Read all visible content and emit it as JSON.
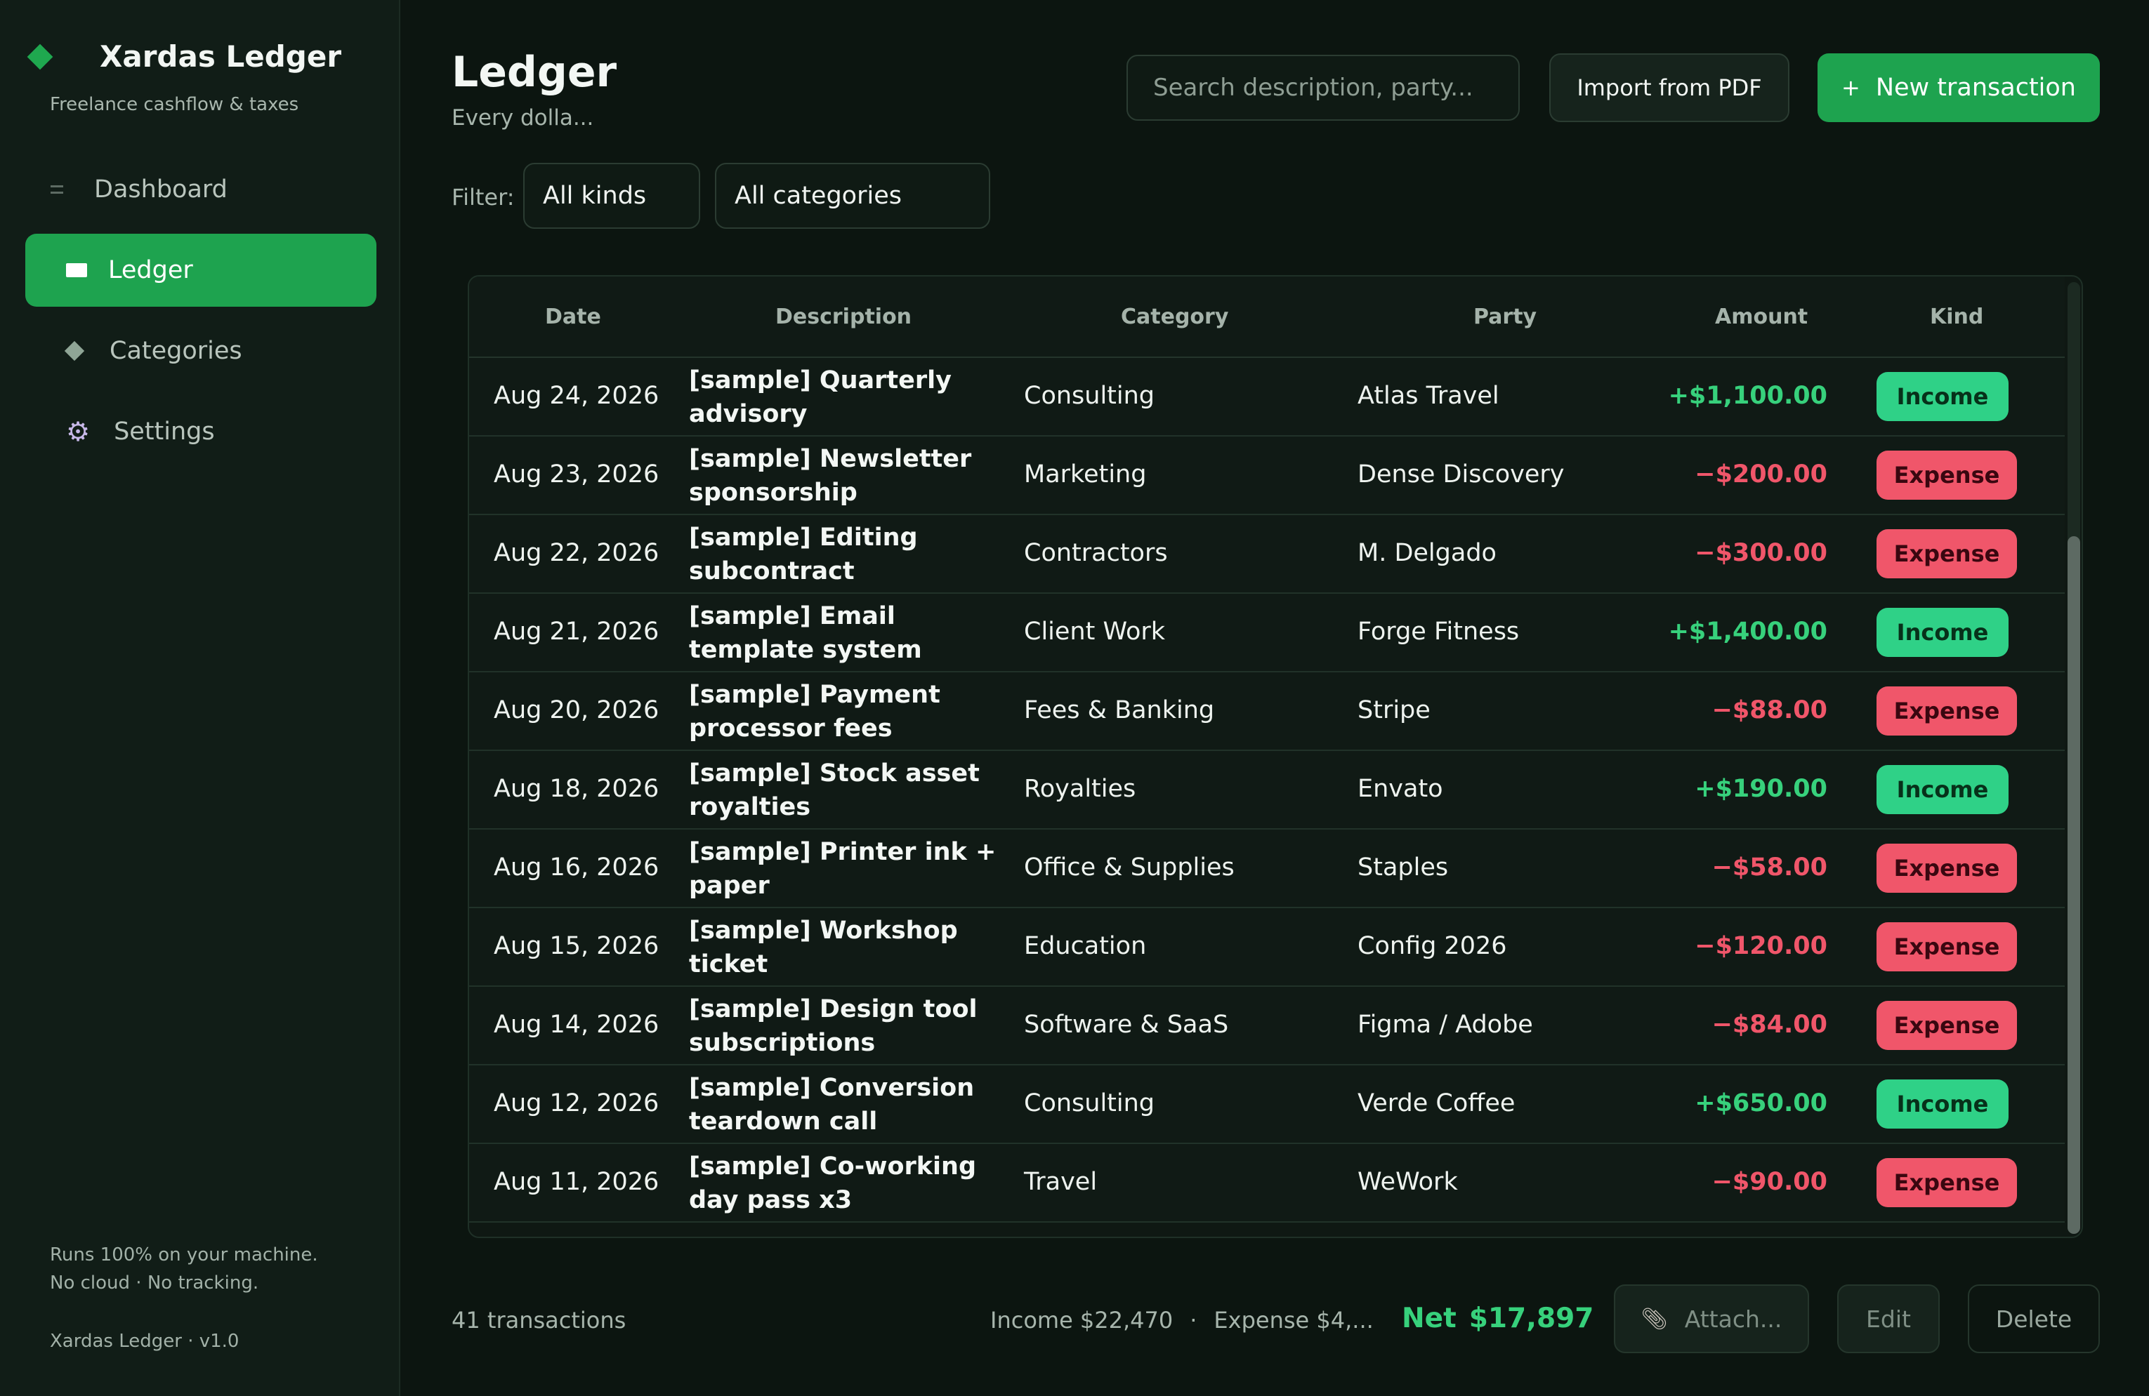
{
  "app": {
    "name": "Xardas Ledger",
    "tagline": "Freelance cashflow & taxes",
    "footer_line1": "Runs 100% on your machine.",
    "footer_line2": "No cloud · No tracking.",
    "version": "Xardas Ledger · v1.0",
    "accent_color": "#1ea34f"
  },
  "nav": {
    "items": [
      {
        "label": "Dashboard",
        "icon": "dashboard-icon",
        "active": false
      },
      {
        "label": "Ledger",
        "icon": "ledger-icon",
        "active": true
      },
      {
        "label": "Categories",
        "icon": "diamond-icon",
        "active": false
      },
      {
        "label": "Settings",
        "icon": "gear-icon",
        "active": false
      }
    ]
  },
  "header": {
    "title": "Ledger",
    "subtitle": "Every dolla...",
    "search_placeholder": "Search description, party...",
    "import_label": "Import from PDF",
    "new_label": "New transaction",
    "new_icon": "+"
  },
  "filters": {
    "label": "Filter:",
    "kind": "All kinds",
    "category": "All categories"
  },
  "table": {
    "headers": {
      "date": "Date",
      "description": "Description",
      "category": "Category",
      "party": "Party",
      "amount": "Amount",
      "kind": "Kind"
    },
    "rows": [
      {
        "date": "Aug 24, 2026",
        "description": "[sample] Quarterly advisory",
        "category": "Consulting",
        "party": "Atlas Travel",
        "amount": "+$1,100.00",
        "kind": "Income"
      },
      {
        "date": "Aug 23, 2026",
        "description": "[sample] Newsletter sponsorship",
        "category": "Marketing",
        "party": "Dense Discovery",
        "amount": "−$200.00",
        "kind": "Expense"
      },
      {
        "date": "Aug 22, 2026",
        "description": "[sample] Editing subcontract",
        "category": "Contractors",
        "party": "M. Delgado",
        "amount": "−$300.00",
        "kind": "Expense"
      },
      {
        "date": "Aug 21, 2026",
        "description": "[sample] Email template system",
        "category": "Client Work",
        "party": "Forge Fitness",
        "amount": "+$1,400.00",
        "kind": "Income"
      },
      {
        "date": "Aug 20, 2026",
        "description": "[sample] Payment processor fees",
        "category": "Fees & Banking",
        "party": "Stripe",
        "amount": "−$88.00",
        "kind": "Expense"
      },
      {
        "date": "Aug 18, 2026",
        "description": "[sample] Stock asset royalties",
        "category": "Royalties",
        "party": "Envato",
        "amount": "+$190.00",
        "kind": "Income"
      },
      {
        "date": "Aug 16, 2026",
        "description": "[sample] Printer ink + paper",
        "category": "Office & Supplies",
        "party": "Staples",
        "amount": "−$58.00",
        "kind": "Expense"
      },
      {
        "date": "Aug 15, 2026",
        "description": "[sample] Workshop ticket",
        "category": "Education",
        "party": "Config 2026",
        "amount": "−$120.00",
        "kind": "Expense"
      },
      {
        "date": "Aug 14, 2026",
        "description": "[sample] Design tool subscriptions",
        "category": "Software & SaaS",
        "party": "Figma / Adobe",
        "amount": "−$84.00",
        "kind": "Expense"
      },
      {
        "date": "Aug 12, 2026",
        "description": "[sample] Conversion teardown call",
        "category": "Consulting",
        "party": "Verde Coffee",
        "amount": "+$650.00",
        "kind": "Income"
      },
      {
        "date": "Aug 11, 2026",
        "description": "[sample] Co-working day pass x3",
        "category": "Travel",
        "party": "WeWork",
        "amount": "−$90.00",
        "kind": "Expense"
      }
    ]
  },
  "footer": {
    "count": "41 transactions",
    "income": "Income $22,470",
    "separator": "·",
    "expense": "Expense $4,...",
    "net_label": "Net",
    "net_value": "$17,897",
    "attach_label": "Attach...",
    "attach_icon": "paperclip-icon",
    "edit_label": "Edit",
    "delete_label": "Delete"
  },
  "colors": {
    "income": "#37d17c",
    "expense": "#f0566a",
    "background": "#0c1510"
  }
}
